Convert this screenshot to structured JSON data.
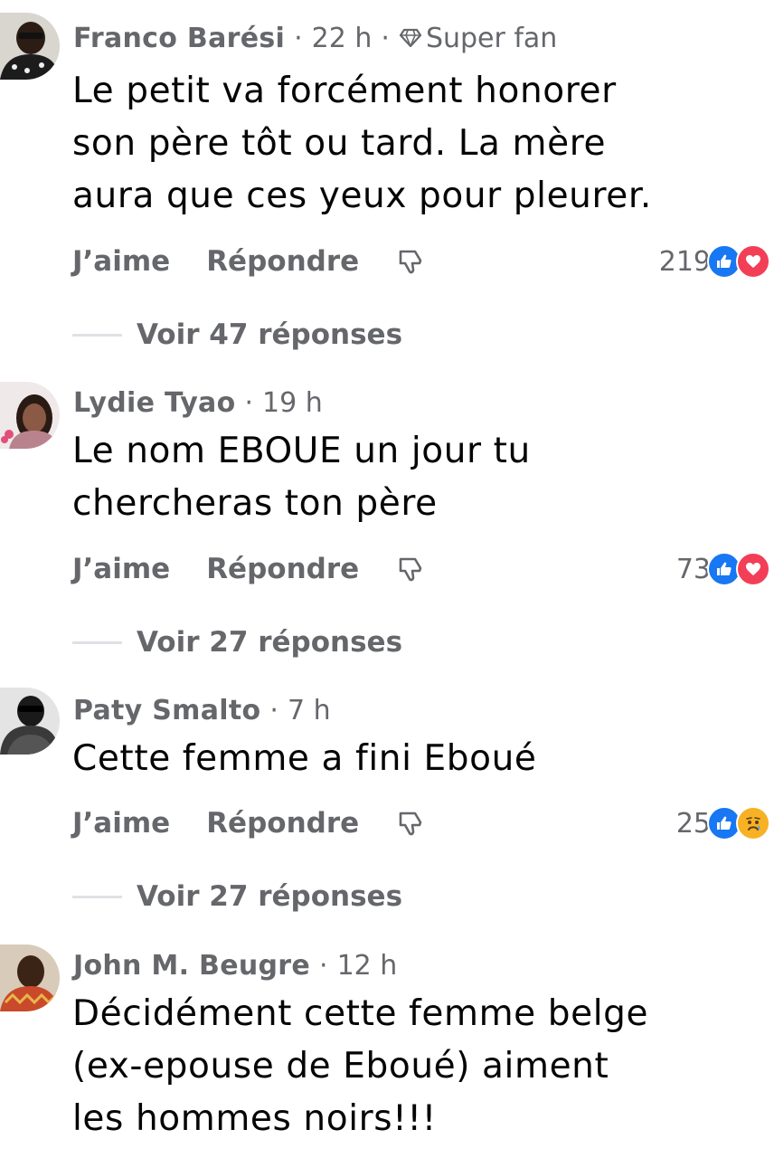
{
  "comments": [
    {
      "author": "Franco Barési",
      "time": "22 h",
      "badge": "Super fan",
      "text_lines": [
        "Le petit va forcément honorer",
        "son père tôt ou tard. La mère",
        "aura que ces yeux pour pleurer."
      ],
      "like_label": "J’aime",
      "reply_label": "Répondre",
      "reaction_count": "219",
      "reactions": [
        "like-icon",
        "love-icon"
      ],
      "replies_label": "Voir 47 réponses"
    },
    {
      "author": "Lydie Tyao",
      "time": "19 h",
      "text_lines": [
        "Le nom EBOUE  un jour tu",
        "chercheras ton père"
      ],
      "like_label": "J’aime",
      "reply_label": "Répondre",
      "reaction_count": "73",
      "reactions": [
        "like-icon",
        "love-icon"
      ],
      "replies_label": "Voir 27 réponses"
    },
    {
      "author": "Paty Smalto",
      "time": "7 h",
      "text_lines": [
        "Cette femme a fini Eboué"
      ],
      "like_label": "J’aime",
      "reply_label": "Répondre",
      "reaction_count": "25",
      "reactions": [
        "like-icon",
        "sad-icon"
      ],
      "replies_label": "Voir 27 réponses"
    },
    {
      "author": "John M. Beugre",
      "time": "12 h",
      "text_lines": [
        "Décidément cette femme belge",
        "(ex-epouse de Eboué) aiment",
        "les hommes noirs!!!"
      ]
    }
  ],
  "colors": {
    "meta_gray": "#65676b",
    "text": "#050505",
    "like_blue": "#1877f2",
    "love_red": "#f33e58",
    "sad_yellow": "#f7b125"
  }
}
